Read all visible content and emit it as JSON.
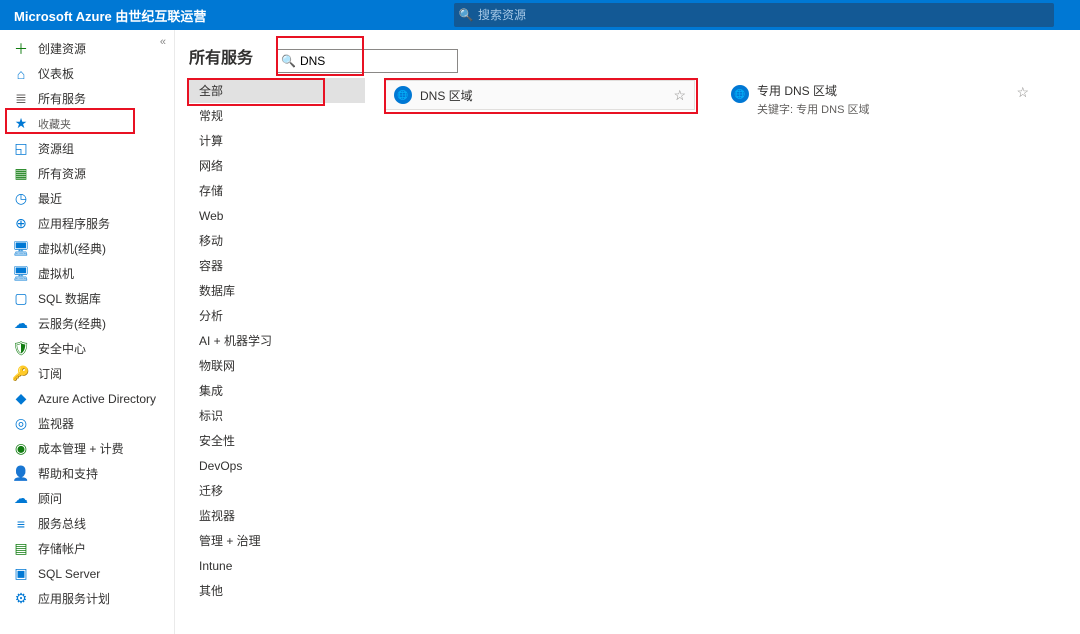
{
  "header": {
    "brand": "Microsoft Azure 由世纪互联运营",
    "search_placeholder": "搜索资源"
  },
  "sidebar": {
    "collapse_glyph": "«",
    "items": [
      {
        "id": "create",
        "label": "创建资源",
        "icon": "＋",
        "color": "#107c10"
      },
      {
        "id": "dashboard",
        "label": "仪表板",
        "icon": "⌂",
        "color": "#0078d4"
      },
      {
        "id": "all-services",
        "label": "所有服务",
        "icon": "≣",
        "color": "#605e5c"
      },
      {
        "id": "favorites",
        "label": "收藏夹",
        "icon": "★",
        "color": "#0078d4",
        "fav": true
      },
      {
        "id": "resource-groups",
        "label": "资源组",
        "icon": "◱",
        "color": "#0078d4"
      },
      {
        "id": "all-resources",
        "label": "所有资源",
        "icon": "▦",
        "color": "#107c10"
      },
      {
        "id": "recent",
        "label": "最近",
        "icon": "◷",
        "color": "#0078d4"
      },
      {
        "id": "app-services",
        "label": "应用程序服务",
        "icon": "⊕",
        "color": "#0078d4"
      },
      {
        "id": "vm-classic",
        "label": "虚拟机(经典)",
        "icon": "🖥",
        "color": "#0078d4"
      },
      {
        "id": "vm",
        "label": "虚拟机",
        "icon": "🖥",
        "color": "#0078d4"
      },
      {
        "id": "sql-db",
        "label": "SQL 数据库",
        "icon": "▢",
        "color": "#0078d4"
      },
      {
        "id": "cloud-svc",
        "label": "云服务(经典)",
        "icon": "☁",
        "color": "#0078d4"
      },
      {
        "id": "security",
        "label": "安全中心",
        "icon": "🛡",
        "color": "#107c10"
      },
      {
        "id": "subscriptions",
        "label": "订阅",
        "icon": "🔑",
        "color": "#c2960b"
      },
      {
        "id": "aad",
        "label": "Azure Active Directory",
        "icon": "◆",
        "color": "#0078d4"
      },
      {
        "id": "monitor",
        "label": "监视器",
        "icon": "◎",
        "color": "#0078d4"
      },
      {
        "id": "cost",
        "label": "成本管理 + 计费",
        "icon": "◉",
        "color": "#107c10"
      },
      {
        "id": "help",
        "label": "帮助和支持",
        "icon": "👤",
        "color": "#0078d4"
      },
      {
        "id": "advisor",
        "label": "顾问",
        "icon": "☁",
        "color": "#0078d4"
      },
      {
        "id": "service-bus",
        "label": "服务总线",
        "icon": "≡",
        "color": "#0078d4"
      },
      {
        "id": "storage",
        "label": "存储帐户",
        "icon": "▤",
        "color": "#107c10"
      },
      {
        "id": "sql-server",
        "label": "SQL Server",
        "icon": "▣",
        "color": "#0078d4"
      },
      {
        "id": "app-plan",
        "label": "应用服务计划",
        "icon": "⚙",
        "color": "#0078d4"
      }
    ]
  },
  "main": {
    "title": "所有服务",
    "filter_value": "DNS",
    "categories": [
      "全部",
      "常规",
      "计算",
      "网络",
      "存储",
      "Web",
      "移动",
      "容器",
      "数据库",
      "分析",
      "AI + 机器学习",
      "物联网",
      "集成",
      "标识",
      "安全性",
      "DevOps",
      "迁移",
      "监视器",
      "管理 + 治理",
      "Intune",
      "其他"
    ],
    "active_category_index": 0,
    "results": {
      "col1": {
        "name": "DNS 区域",
        "icon_label": "DNS"
      },
      "col2": {
        "name": "专用 DNS 区域",
        "keyword_label": "关键字:",
        "keyword_value": "专用 DNS 区域",
        "icon_label": "DNS"
      }
    }
  }
}
